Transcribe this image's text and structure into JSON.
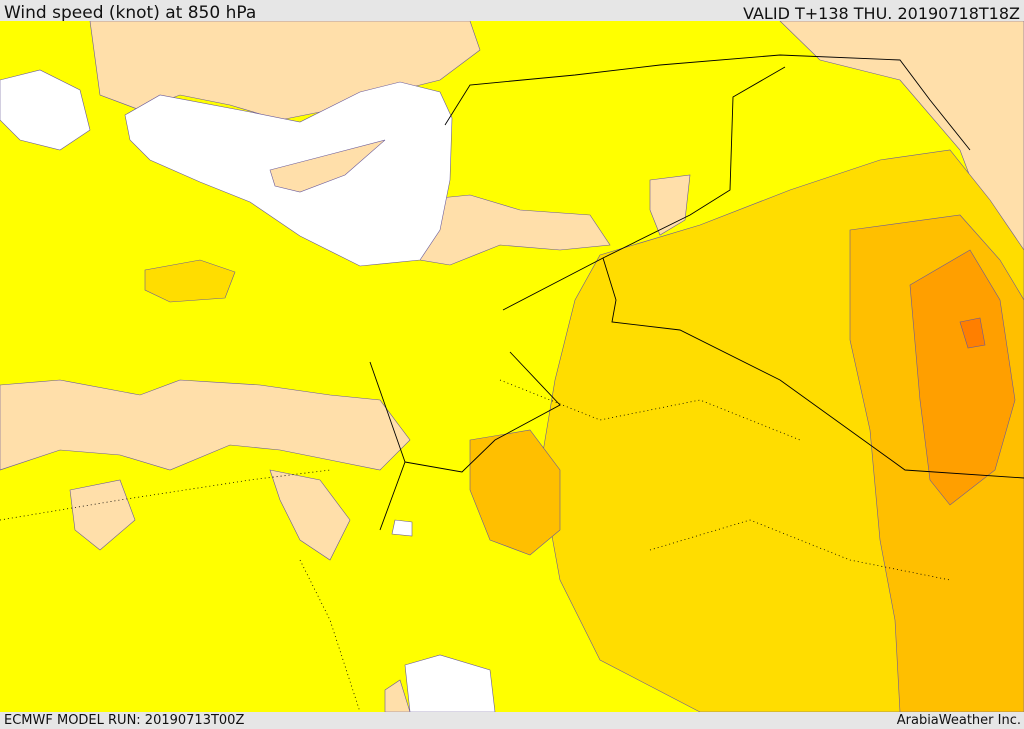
{
  "header": {
    "title": "Wind speed (knot) at 850 hPa",
    "valid": "VALID T+138 THU. 20190718T18Z"
  },
  "footer": {
    "model_run": "ECMWF MODEL RUN: 20190713T00Z",
    "brand": "ArabiaWeather Inc."
  },
  "colors": {
    "sea": "#ffffff",
    "band_low": "#ffdfaa",
    "band_mid": "#ffff00",
    "band_high": "#ffdd00",
    "band_higher": "#ffbf00",
    "band_highest": "#ff9f00",
    "band_peak": "#ff7f00"
  }
}
